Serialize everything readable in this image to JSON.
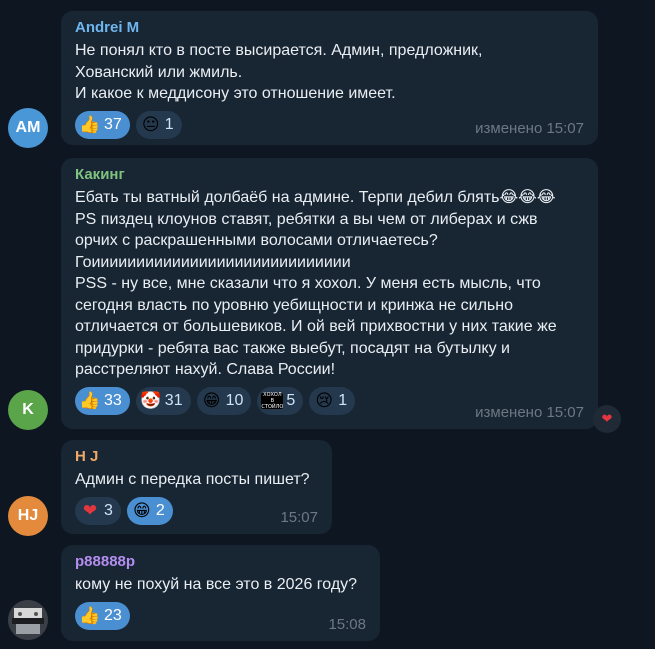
{
  "colors": {
    "background": "#0e1621",
    "bubble": "#182533",
    "reaction_bg": "#24394d",
    "reaction_chosen": "#4a8fd1",
    "meta": "#6c7883"
  },
  "messages": [
    {
      "author": "Andrei M",
      "author_color": "#6fb6ef",
      "avatar": {
        "initials": "AM",
        "color": "#4a97d8"
      },
      "lines": [
        "Не понял кто в посте высирается. Админ, предложник,",
        "Хованский или жмиль.",
        "И какое к меддисону это отношение имеет."
      ],
      "reactions": [
        {
          "icon": "thumbs-up-icon",
          "emoji": "👍",
          "count": "37",
          "chosen": true
        },
        {
          "icon": "neutral-face-icon",
          "emoji": "😐",
          "count": "1",
          "chosen": false
        }
      ],
      "meta": "изменено 15:07"
    },
    {
      "author": "Какинг",
      "author_color": "#7fc380",
      "avatar": {
        "initials": "K",
        "color": "#5aa44a"
      },
      "lines": [
        "Ебать ты ватный долбаёб на админе. Терпи дебил блять😂😂😂",
        "PS пиздец клоунов ставят, ребятки а вы чем от либерах и сжв",
        "орчих с раскрашенными волосами отличаетесь?",
        "Гоиииииииииииииииииииииииииииии",
        "PSS - ну все, мне сказали что я хохол. У меня есть мысль, что",
        "сегодня власть по уровню уебищности и кринжа не сильно",
        "отличается от большевиков. И ой вей прихвостни у них такие же",
        "придурки - ребята вас также выебут, посадят на бутылку и",
        "расстреляют нахуй. Слава России!"
      ],
      "reactions": [
        {
          "icon": "thumbs-up-icon",
          "emoji": "👍",
          "count": "33",
          "chosen": true
        },
        {
          "icon": "clown-face-icon",
          "emoji": "🤡",
          "count": "31",
          "chosen": false
        },
        {
          "icon": "grinning-face-icon",
          "emoji": "😁",
          "count": "10",
          "chosen": false
        },
        {
          "icon": "custom-sticker-icon",
          "emoji": "",
          "sticker_text": [
            "ХОХОЛ",
            "В СТОЙЛО"
          ],
          "count": "5",
          "chosen": false
        },
        {
          "icon": "crying-face-icon",
          "emoji": "😢",
          "count": "1",
          "chosen": false
        }
      ],
      "meta": "изменено 15:07",
      "side_reaction": {
        "icon": "heart-icon",
        "emoji": "❤"
      }
    },
    {
      "author": "H J",
      "author_color": "#f0a866",
      "avatar": {
        "initials": "HJ",
        "color": "#e38a3c"
      },
      "lines": [
        "Админ с передка посты пишет?"
      ],
      "reactions": [
        {
          "icon": "heart-icon",
          "emoji": "❤",
          "count": "3",
          "chosen": false
        },
        {
          "icon": "grinning-face-icon",
          "emoji": "😁",
          "count": "2",
          "chosen": true
        }
      ],
      "meta": "15:07"
    },
    {
      "author": "p88888p",
      "author_color": "#b38ef0",
      "avatar": {
        "initials": "",
        "color": "#2b2f36"
      },
      "lines": [
        "кому не похуй на все это в 2026 году?"
      ],
      "reactions": [
        {
          "icon": "thumbs-up-icon",
          "emoji": "👍",
          "count": "23",
          "chosen": true
        }
      ],
      "meta": "15:08"
    }
  ]
}
